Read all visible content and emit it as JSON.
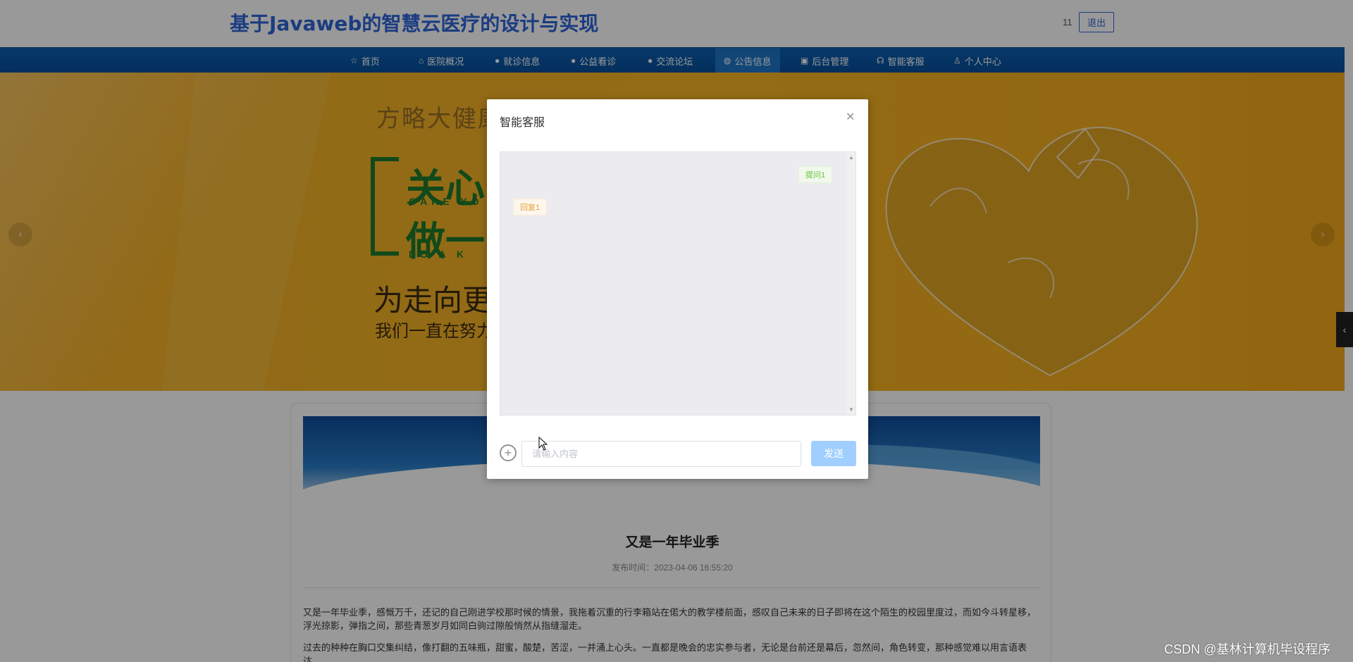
{
  "header": {
    "title": "基于Javaweb的智慧云医疗的设计与实现",
    "user_name": "11",
    "logout_label": "退出"
  },
  "nav": {
    "items": [
      {
        "label": "首页",
        "icon": "star-icon"
      },
      {
        "label": "医院概况",
        "icon": "home-icon"
      },
      {
        "label": "就诊信息",
        "icon": "dot-icon"
      },
      {
        "label": "公益看诊",
        "icon": "dot-icon"
      },
      {
        "label": "交流论坛",
        "icon": "dot-icon"
      },
      {
        "label": "公告信息",
        "icon": "globe-icon"
      },
      {
        "label": "后台管理",
        "icon": "box-icon"
      },
      {
        "label": "智能客服",
        "icon": "headset-icon"
      },
      {
        "label": "个人中心",
        "icon": "user-icon"
      }
    ],
    "active_index": 5
  },
  "banner": {
    "slogan_small": "方略大健康",
    "care_line1": "关心",
    "care_line1_en": "CARE YO",
    "care_line2": "做一",
    "care_line2_en": "DO A K",
    "slogan_mid": "为走向更健",
    "slogan_sub": "我们一直在努力"
  },
  "article": {
    "title": "又是一年毕业季",
    "meta": "发布时间：2023-04-06 16:55:20",
    "paragraphs": [
      "又是一年毕业季，感慨万千，还记的自己刚进学校那时候的情景，我拖着沉重的行李箱站在偌大的教学楼前面，感叹自己未来的日子即将在这个陌生的校园里度过，而如今斗转星移，浮光掠影，弹指之间，那些青葱岁月如同白驹过隙般悄然从指缝溜走。",
      "过去的种种在胸口交集纠结，像打翻的五味瓶，甜蜜，酸楚，苦涩，一并涌上心头。一直都是晚会的忠实参与者，无论是台前还是幕后，忽然间，角色转变，那种感觉难以用言语表达。"
    ]
  },
  "dialog": {
    "title": "智能客服",
    "messages": [
      {
        "role": "question",
        "text": "提问1"
      },
      {
        "role": "answer",
        "text": "回复1"
      }
    ],
    "input_placeholder": "请输入内容",
    "send_label": "发送"
  },
  "watermark": "CSDN @基林计算机毕设程序",
  "colors": {
    "brand": "#2e64d8",
    "nav_bg": "#0c5fb2",
    "banner": "#f3b02a",
    "send": "#a0cfff"
  }
}
